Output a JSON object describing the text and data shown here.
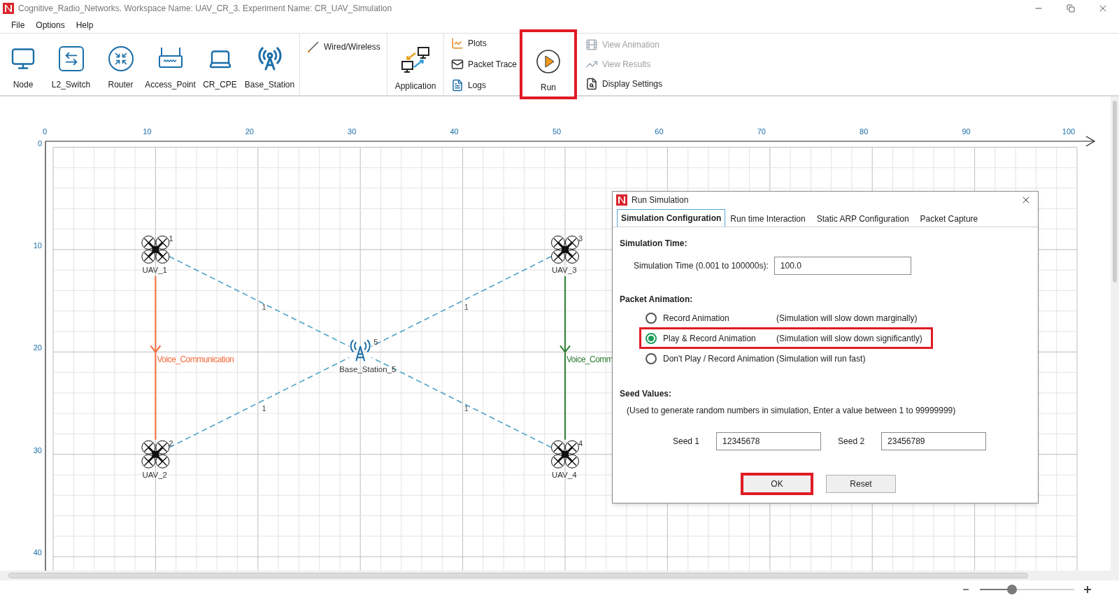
{
  "window": {
    "title": "Cognitive_Radio_Networks. Workspace Name: UAV_CR_3. Experiment Name: CR_UAV_Simulation"
  },
  "menu": [
    "File",
    "Options",
    "Help"
  ],
  "toolbar": {
    "devices": [
      {
        "label": "Node",
        "kind": "node"
      },
      {
        "label": "L2_Switch",
        "kind": "switch"
      },
      {
        "label": "Router",
        "kind": "router"
      },
      {
        "label": "Access_Point",
        "kind": "access_point"
      },
      {
        "label": "CR_CPE",
        "kind": "cpe"
      },
      {
        "label": "Base_Station",
        "kind": "base_station"
      }
    ],
    "link": {
      "label": "Wired/Wireless"
    },
    "application": {
      "label": "Application"
    },
    "outputs": [
      {
        "label": "Plots",
        "kind": "plots"
      },
      {
        "label": "Packet Trace",
        "kind": "trace"
      },
      {
        "label": "Logs",
        "kind": "logs"
      }
    ],
    "run": {
      "label": "Run",
      "highlighted": true
    },
    "views": [
      {
        "label": "View Animation",
        "kind": "animation",
        "disabled": true
      },
      {
        "label": "View Results",
        "kind": "results",
        "disabled": true
      },
      {
        "label": "Display Settings",
        "kind": "display",
        "disabled": false
      }
    ]
  },
  "canvas": {
    "x_ticks": [
      "0",
      "10",
      "20",
      "30",
      "40",
      "50",
      "60",
      "70",
      "80",
      "90",
      "100"
    ],
    "y_ticks": [
      "0",
      "10",
      "20",
      "30",
      "40"
    ],
    "nodes": [
      {
        "kind": "uav",
        "id": "1",
        "label": "UAV_1"
      },
      {
        "kind": "uav",
        "id": "2",
        "label": "UAV_2"
      },
      {
        "kind": "uav",
        "id": "3",
        "label": "UAV_3"
      },
      {
        "kind": "uav",
        "id": "4",
        "label": "UAV_4"
      },
      {
        "kind": "base_station",
        "id": "5",
        "label": "Base_Station_5"
      }
    ],
    "links": [
      {
        "label": "1"
      },
      {
        "label": "1"
      },
      {
        "label": "1"
      },
      {
        "label": "1"
      }
    ],
    "applications": [
      {
        "label": "Voice_Communication",
        "color": "#f4683a"
      },
      {
        "label": "Voice_Comm",
        "color": "#2e7d32"
      }
    ]
  },
  "dialog": {
    "title": "Run Simulation",
    "tabs": [
      {
        "label": "Simulation Configuration",
        "selected": true
      },
      {
        "label": "Run time Interaction",
        "selected": false
      },
      {
        "label": "Static ARP Configuration",
        "selected": false
      },
      {
        "label": "Packet Capture",
        "selected": false
      }
    ],
    "simulation_time": {
      "heading": "Simulation Time:",
      "label": "Simulation Time (0.001 to 100000s):",
      "value": "100.0"
    },
    "packet_animation": {
      "heading": "Packet Animation:",
      "options": [
        {
          "label": "Record Animation",
          "note": "(Simulation will slow down marginally)",
          "selected": false,
          "highlighted": false
        },
        {
          "label": "Play & Record Animation",
          "note": "(Simulation will slow down significantly)",
          "selected": true,
          "highlighted": true
        },
        {
          "label": "Don't Play / Record Animation",
          "note": "(Simulation will run fast)",
          "selected": false,
          "highlighted": false
        }
      ]
    },
    "seed_values": {
      "heading": "Seed Values:",
      "note": "(Used to generate random numbers in simulation, Enter a value between 1 to 99999999)",
      "seeds": [
        {
          "label": "Seed 1",
          "value": "12345678"
        },
        {
          "label": "Seed 2",
          "value": "23456789"
        }
      ]
    },
    "buttons": [
      {
        "label": "OK",
        "highlighted": true
      },
      {
        "label": "Reset",
        "highlighted": false
      }
    ]
  },
  "zoom": {
    "level": 0.34
  }
}
